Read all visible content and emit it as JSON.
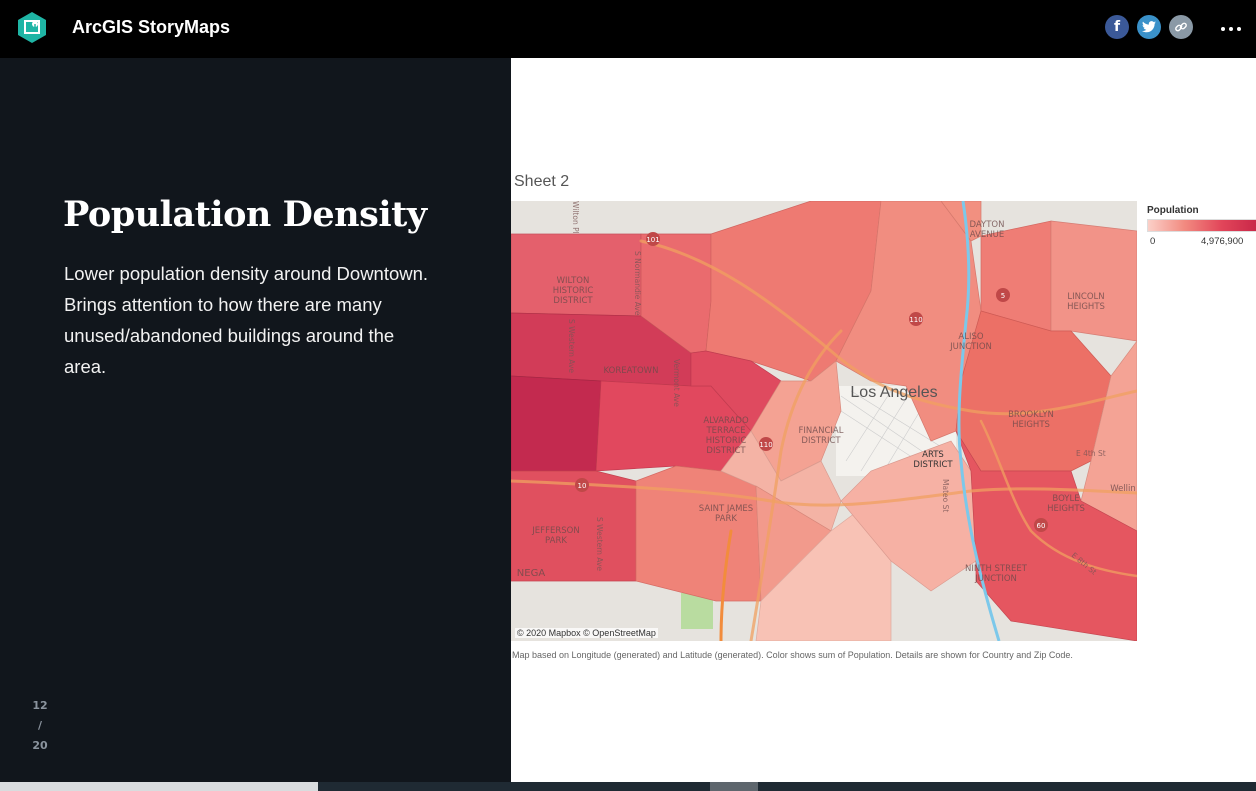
{
  "header": {
    "app_title": "ArcGIS StoryMaps",
    "share": {
      "facebook_glyph": "f",
      "twitter_glyph": "t",
      "link_glyph": "⚭"
    },
    "more_glyph": "⋮",
    "icons": [
      "storymaps-logo-icon",
      "facebook-icon",
      "twitter-icon",
      "link-icon",
      "more-options-icon"
    ]
  },
  "panel": {
    "title": "Population Density",
    "body": "Lower population density around Downtown. Brings attention to how there are many unused/abandoned buildings around the area.",
    "progress": {
      "current": "12",
      "separator": "/",
      "total": "20"
    }
  },
  "viz": {
    "sheet_title": "Sheet 2",
    "map_attribution": "© 2020 Mapbox © OpenStreetMap",
    "caption": "Map based on Longitude (generated) and Latitude (generated).  Color shows sum of Population.  Details are shown for Country and Zip Code.",
    "legend": {
      "title": "Population",
      "min": "0",
      "max": "4,976,900",
      "colors": [
        "#fbd0c8",
        "#f28a80",
        "#e2465a",
        "#c82648"
      ]
    },
    "map_labels": {
      "city": "Los Angeles",
      "arts_district_1": "ARTS",
      "arts_district_2": "DISTRICT",
      "koreatown": "KOREATOWN",
      "wilton_1": "WILTON",
      "wilton_2": "HISTORIC",
      "wilton_3": "DISTRICT",
      "saint_james_1": "SAINT JAMES",
      "saint_james_2": "PARK",
      "jefferson_1": "JEFFERSON",
      "jefferson_2": "PARK",
      "boyle_1": "BOYLE",
      "boyle_2": "HEIGHTS",
      "lincoln_1": "LINCOLN",
      "lincoln_2": "HEIGHTS",
      "dayton_1": "DAYTON",
      "dayton_2": "AVENUE",
      "ninth_1": "NINTH STREET",
      "ninth_2": "JUNCTION",
      "alvarado_1": "ALVARADO",
      "alvarado_2": "TERRACE",
      "alvarado_3": "HISTORIC",
      "alvarado_4": "DISTRICT",
      "financial_1": "FINANCIAL",
      "financial_2": "DISTRICT",
      "aliso_1": "ALISO",
      "aliso_2": "JUNCTION",
      "brooklyn_1": "BROOKLYN",
      "brooklyn_2": "HEIGHTS",
      "negra": "NEGA",
      "wellin": "Wellin",
      "wilton_pl": "Wilton Pl",
      "normandie": "S Normandie Ave",
      "western": "S Western Ave",
      "vermont": "Vermont Ave",
      "st_e": "E 4th St",
      "e8th": "E 8th St",
      "mateo": "Mateo St",
      "hwy_101": "101",
      "hwy_110": "110",
      "hwy_10": "10",
      "hwy_60": "60",
      "hwy_5": "5"
    }
  }
}
